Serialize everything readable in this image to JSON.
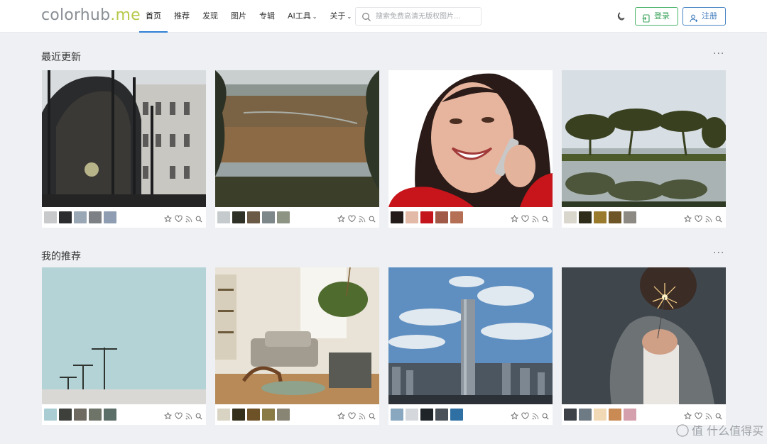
{
  "header": {
    "logo_main": "colorhub",
    "logo_suffix": ".me",
    "nav": [
      {
        "label": "首页",
        "active": true,
        "caret": false
      },
      {
        "label": "推荐",
        "active": false,
        "caret": false
      },
      {
        "label": "发现",
        "active": false,
        "caret": false
      },
      {
        "label": "图片",
        "active": false,
        "caret": false
      },
      {
        "label": "专辑",
        "active": false,
        "caret": false
      },
      {
        "label": "AI工具",
        "active": false,
        "caret": true
      },
      {
        "label": "关于",
        "active": false,
        "caret": true
      }
    ],
    "search_placeholder": "搜索免费高清无版权图片...",
    "login_label": "登录",
    "register_label": "注册"
  },
  "sections": [
    {
      "title": "最近更新",
      "more": "···",
      "cards": [
        {
          "photo": "arch-building-icon",
          "swatches": [
            "#c8c9cb",
            "#2b2c2e",
            "#9aa7b5",
            "#7d8084",
            "#8e9db2"
          ]
        },
        {
          "photo": "marsh-landscape-icon",
          "swatches": [
            "#c5cbcd",
            "#2f3126",
            "#6b5a45",
            "#7e878a",
            "#8e9483"
          ]
        },
        {
          "photo": "woman-phone-icon",
          "swatches": [
            "#231b1a",
            "#e3b9a8",
            "#c4141c",
            "#a05a47",
            "#b46f55"
          ]
        },
        {
          "photo": "trees-lake-icon",
          "swatches": [
            "#d9d6ce",
            "#2f2d1a",
            "#9a7b2d",
            "#6e5527",
            "#8c8a83"
          ]
        }
      ]
    },
    {
      "title": "我的推荐",
      "more": "···",
      "cards": [
        {
          "photo": "streetlights-icon",
          "swatches": [
            "#a9cdd2",
            "#3e403c",
            "#6f6a61",
            "#6e7468",
            "#5c6e68"
          ]
        },
        {
          "photo": "living-room-icon",
          "swatches": [
            "#d8d3c3",
            "#34301c",
            "#6d5228",
            "#8a7a46",
            "#888575"
          ]
        },
        {
          "photo": "skyscraper-icon",
          "swatches": [
            "#89a7be",
            "#d4d8dc",
            "#1e2428",
            "#4b5158",
            "#2f70a4"
          ]
        },
        {
          "photo": "sparkler-icon",
          "swatches": [
            "#3c4247",
            "#6e7b84",
            "#f1d9b6",
            "#c98a53",
            "#d4a0ad"
          ]
        }
      ]
    }
  ],
  "watermark": "值 什么值得买"
}
